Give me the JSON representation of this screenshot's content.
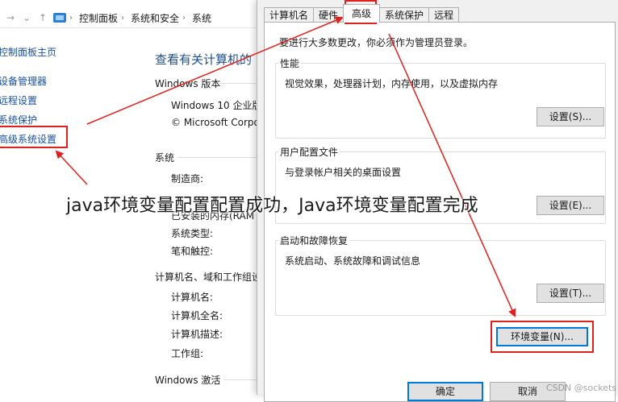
{
  "control_panel": {
    "breadcrumb": [
      "控制面板",
      "系统和安全",
      "系统"
    ],
    "left_links": [
      "控制面板主页",
      "设备管理器",
      "远程设置",
      "系统保护",
      "高级系统设置"
    ],
    "page_title": "查看有关计算机的",
    "windows_edition": {
      "heading": "Windows 版本",
      "lines": [
        "Windows 10 企业版",
        "© Microsoft Corpo"
      ]
    },
    "system": {
      "heading": "系统",
      "rows": [
        "制造商:",
        "已安装的内存(RAM",
        "系统类型:",
        "笔和触控:"
      ]
    },
    "computer_name": {
      "heading": "计算机名、域和工作组设",
      "rows": [
        "计算机名:",
        "计算机全名:",
        "计算机描述:",
        "工作组:"
      ]
    },
    "activation_heading": "Windows 激活"
  },
  "dialog": {
    "tabs": [
      "计算机名",
      "硬件",
      "高级",
      "系统保护",
      "远程"
    ],
    "notice": "要进行大多数更改，你必须作为管理员登录。",
    "performance": {
      "title": "性能",
      "desc": "视觉效果，处理器计划，内存使用，以及虚拟内存",
      "button": "设置(S)..."
    },
    "user_profiles": {
      "title": "用户配置文件",
      "desc": "与登录帐户相关的桌面设置",
      "button": "设置(E)..."
    },
    "startup_recovery": {
      "title": "启动和故障恢复",
      "desc": "系统启动、系统故障和调试信息",
      "button": "设置(T)..."
    },
    "env_button": "环境变量(N)...",
    "ok_button": "确定",
    "cancel_button": "取消"
  },
  "overlay_caption": "java环境变量配置配置成功，Java环境变量配置完成",
  "watermark": "CSDN @sockets"
}
